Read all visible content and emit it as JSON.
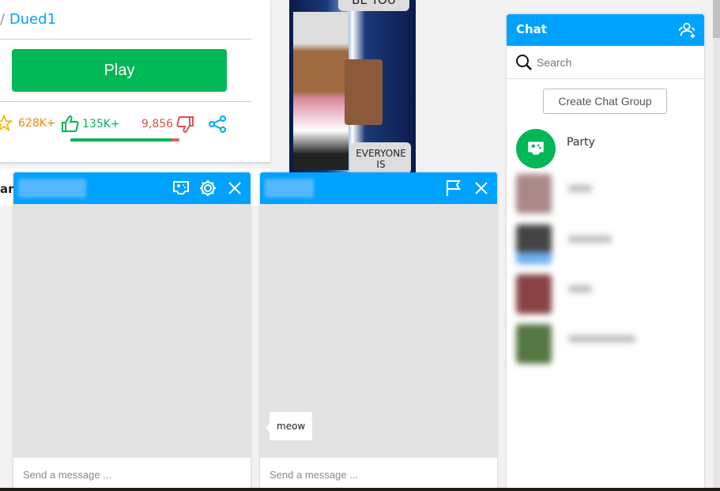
{
  "game": {
    "creator_prefix": "/",
    "creator_name": "Dued1",
    "play_label": "Play",
    "favorites": "628K+",
    "upvotes": "135K+",
    "downvotes": "9,856",
    "upvote_ratio_percent": 93,
    "partial_text": "ard"
  },
  "thumbnail": {
    "caption_top": "BE YOU",
    "caption_bottom": "EVERYONE IS"
  },
  "chat_windows": [
    {
      "input_placeholder": "Send a message ...",
      "icons": [
        "game-icon",
        "gear-icon",
        "close-icon"
      ]
    },
    {
      "input_placeholder": "Send a message ...",
      "icons": [
        "flag-icon",
        "close-icon"
      ],
      "messages": [
        "meow"
      ]
    }
  ],
  "chat_panel": {
    "title": "Chat",
    "search_placeholder": "Search",
    "create_group_label": "Create Chat Group",
    "party_label": "Party"
  },
  "colors": {
    "brand_blue": "#00a2ff",
    "play_green": "#02b757",
    "favorite_orange": "#f68802",
    "downvote_red": "#d9534f"
  }
}
